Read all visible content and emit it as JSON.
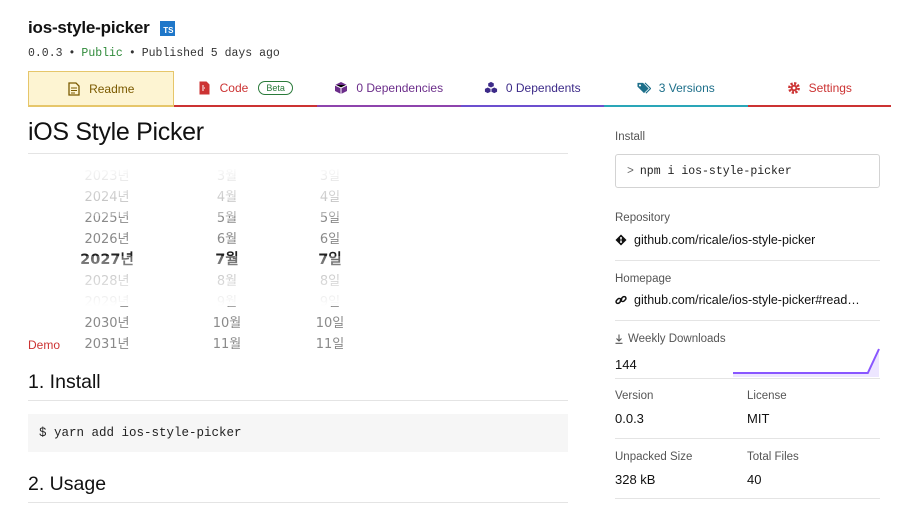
{
  "package": {
    "name": "ios-style-picker",
    "ts_badge": "TS",
    "version": "0.0.3",
    "visibility": "Public",
    "published": "Published 5 days ago",
    "separator": "•"
  },
  "tabs": [
    {
      "label": "Readme",
      "icon": "document-icon",
      "active": true
    },
    {
      "label": "Code",
      "icon": "file-code-icon",
      "badge": "Beta"
    },
    {
      "label": "0 Dependencies",
      "icon": "box-icon"
    },
    {
      "label": "0 Dependents",
      "icon": "boxes-icon"
    },
    {
      "label": "3 Versions",
      "icon": "tags-icon"
    },
    {
      "label": "Settings",
      "icon": "gear-icon"
    }
  ],
  "readme": {
    "title": "iOS Style Picker",
    "picker": {
      "years": [
        "2023년",
        "2024년",
        "2025년",
        "2026년",
        "2027년",
        "2028년",
        "2029년",
        "2030년",
        "2031년"
      ],
      "months": [
        "3월",
        "4월",
        "5월",
        "6월",
        "7월",
        "8월",
        "9월",
        "10월",
        "11월"
      ],
      "days": [
        "3일",
        "4일",
        "5일",
        "6일",
        "7일",
        "8일",
        "9일",
        "10일",
        "11일"
      ],
      "selected_index": 4
    },
    "demo_link": "Demo",
    "install_heading": "1. Install",
    "install_code": "$ yarn add ios-style-picker",
    "usage_heading": "2. Usage"
  },
  "sidebar": {
    "install_label": "Install",
    "install_prompt": ">",
    "install_command": "npm i ios-style-picker",
    "repository_label": "Repository",
    "repository": "github.com/ricale/ios-style-picker",
    "homepage_label": "Homepage",
    "homepage": "github.com/ricale/ios-style-picker#read…",
    "weekly_downloads_label": "Weekly Downloads",
    "weekly_downloads": "144",
    "downloads_trend": [
      0,
      0,
      0,
      0,
      0,
      0,
      0,
      0,
      0,
      0,
      0,
      0,
      0,
      1
    ],
    "version_label": "Version",
    "version": "0.0.3",
    "license_label": "License",
    "license": "MIT",
    "unpacked_size_label": "Unpacked Size",
    "unpacked_size": "328 kB",
    "total_files_label": "Total Files",
    "total_files": "40"
  },
  "colors": {
    "readme_tab_bg": "#fdf4d2",
    "code_red": "#cc3333",
    "dependencies_purple": "#8e44ad",
    "dependents_indigo": "#6c4fcf",
    "versions_teal": "#2aa6b8",
    "sparkline": "#8956ff",
    "public_green": "#2f8a3a",
    "ts_blue": "#1f77c9"
  }
}
